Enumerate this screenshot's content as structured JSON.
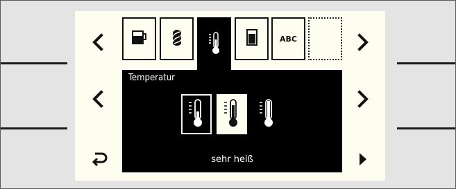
{
  "screen": {
    "tabs": [
      {
        "name": "tab-mug",
        "icon": "mug-icon",
        "active": false
      },
      {
        "name": "tab-beans",
        "icon": "coffee-beans-icon",
        "active": false
      },
      {
        "name": "tab-temperature",
        "icon": "thermometer-icon",
        "active": true
      },
      {
        "name": "tab-water-tank",
        "icon": "water-tank-icon",
        "active": false
      },
      {
        "name": "tab-abc",
        "label": "ABC",
        "active": false
      },
      {
        "name": "tab-empty",
        "active": false
      }
    ],
    "panel": {
      "title": "Temperatur",
      "options": [
        {
          "name": "temp-option-low",
          "icon": "thermometer-low-icon",
          "level": 0.4
        },
        {
          "name": "temp-option-high",
          "icon": "thermometer-high-icon",
          "level": 0.75,
          "selected": true
        },
        {
          "name": "temp-option-very-high",
          "icon": "thermometer-very-high-icon",
          "level": 1.0
        }
      ],
      "selected_label": "sehr heiß"
    },
    "nav": {
      "left_top": "chevron-left-icon",
      "left_middle": "chevron-left-icon",
      "right_top": "chevron-right-icon",
      "right_middle": "chevron-right-icon",
      "back": "back-arrow-icon",
      "next": "play-right-icon"
    }
  },
  "colors": {
    "screen_bg": "#fdfdf0",
    "panel_bg": "#000000",
    "bezel": "#e4e4e4"
  }
}
